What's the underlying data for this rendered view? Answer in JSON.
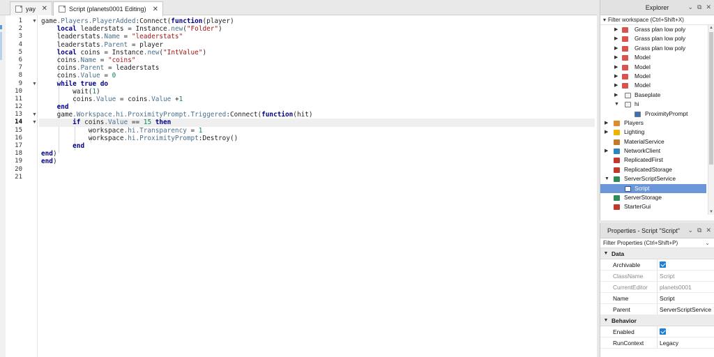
{
  "tabs": [
    {
      "label": "yay",
      "close": "✕"
    },
    {
      "label": "Script (planets0001 Editing)",
      "close": "✕"
    }
  ],
  "line_numbers": [
    "1",
    "2",
    "3",
    "4",
    "5",
    "6",
    "7",
    "8",
    "9",
    "10",
    "11",
    "12",
    "13",
    "14",
    "15",
    "16",
    "17",
    "18",
    "19",
    "20",
    "21"
  ],
  "code_lines": [
    "game.Players.PlayerAdded:Connect(function(player)",
    "    local leaderstats = Instance.new(\"Folder\")",
    "    leaderstats.Name = \"leaderstats\"",
    "    leaderstats.Parent = player",
    "    local coins = Instance.new(\"IntValue\")",
    "    coins.Name = \"coins\"",
    "    coins.Parent = leaderstats",
    "    coins.Value = 0",
    "    while true do",
    "        wait(1)",
    "        coins.Value = coins.Value +1",
    "    end",
    "    game.Workspace.hi.ProximityPrompt.Triggered:Connect(function(hit)",
    "        if coins.Value == 15 then",
    "            workspace.hi.Transparency = 1",
    "            workspace.hi.ProximityPrompt:Destroy()",
    "        end",
    "end)",
    "end)",
    "",
    ""
  ],
  "current_line": 14,
  "explorer": {
    "title": "Explorer",
    "filter_placeholder": "Filter workspace (Ctrl+Shift+X)",
    "items": [
      {
        "label": "Grass plan low poly",
        "icon": "model-icon",
        "color": "#d9534f"
      },
      {
        "label": "Grass plan low poly",
        "icon": "model-icon",
        "color": "#d9534f"
      },
      {
        "label": "Grass plan low poly",
        "icon": "model-icon",
        "color": "#d9534f"
      },
      {
        "label": "Model",
        "icon": "model-icon",
        "color": "#d9534f"
      },
      {
        "label": "Model",
        "icon": "model-icon",
        "color": "#d9534f"
      },
      {
        "label": "Model",
        "icon": "model-icon",
        "color": "#d9534f"
      },
      {
        "label": "Model",
        "icon": "model-icon",
        "color": "#d9534f"
      },
      {
        "label": "Baseplate",
        "icon": "part-icon",
        "color": "#9a9a9a"
      },
      {
        "label": "hi",
        "icon": "part-icon",
        "color": "#9a9a9a"
      },
      {
        "label": "ProximityPrompt",
        "icon": "proximity-prompt-icon",
        "color": "#3b6fc4"
      },
      {
        "label": "Players",
        "icon": "players-icon",
        "color": "#e08a2e"
      },
      {
        "label": "Lighting",
        "icon": "lighting-icon",
        "color": "#f0b400"
      },
      {
        "label": "MaterialService",
        "icon": "material-service-icon",
        "color": "#c47a2c"
      },
      {
        "label": "NetworkClient",
        "icon": "network-client-icon",
        "color": "#2e86c1"
      },
      {
        "label": "ReplicatedFirst",
        "icon": "replicated-first-icon",
        "color": "#c0392b"
      },
      {
        "label": "ReplicatedStorage",
        "icon": "replicated-storage-icon",
        "color": "#c0392b"
      },
      {
        "label": "ServerScriptService",
        "icon": "server-script-service-icon",
        "color": "#2e8b57"
      },
      {
        "label": "Script",
        "icon": "script-icon",
        "color": "#ffffff"
      },
      {
        "label": "ServerStorage",
        "icon": "server-storage-icon",
        "color": "#2e8b57"
      },
      {
        "label": "StarterGui",
        "icon": "starter-gui-icon",
        "color": "#c0392b"
      }
    ]
  },
  "properties": {
    "title": "Properties - Script \"Script\"",
    "filter_placeholder": "Filter Properties (Ctrl+Shift+P)",
    "sections": {
      "data": "Data",
      "behavior": "Behavior"
    },
    "rows": {
      "archivable": {
        "name": "Archivable",
        "checked": true
      },
      "classname": {
        "name": "ClassName",
        "value": "Script"
      },
      "currenteditor": {
        "name": "CurrentEditor",
        "value": "planets0001"
      },
      "name": {
        "name": "Name",
        "value": "Script"
      },
      "parent": {
        "name": "Parent",
        "value": "ServerScriptService"
      },
      "enabled": {
        "name": "Enabled",
        "checked": true
      },
      "runcontext": {
        "name": "RunContext",
        "value": "Legacy"
      }
    }
  },
  "colors": {
    "selection": "#6b96d8",
    "checkbox": "#1f7ed6",
    "keyword": "#00008b",
    "string": "#a31515"
  }
}
